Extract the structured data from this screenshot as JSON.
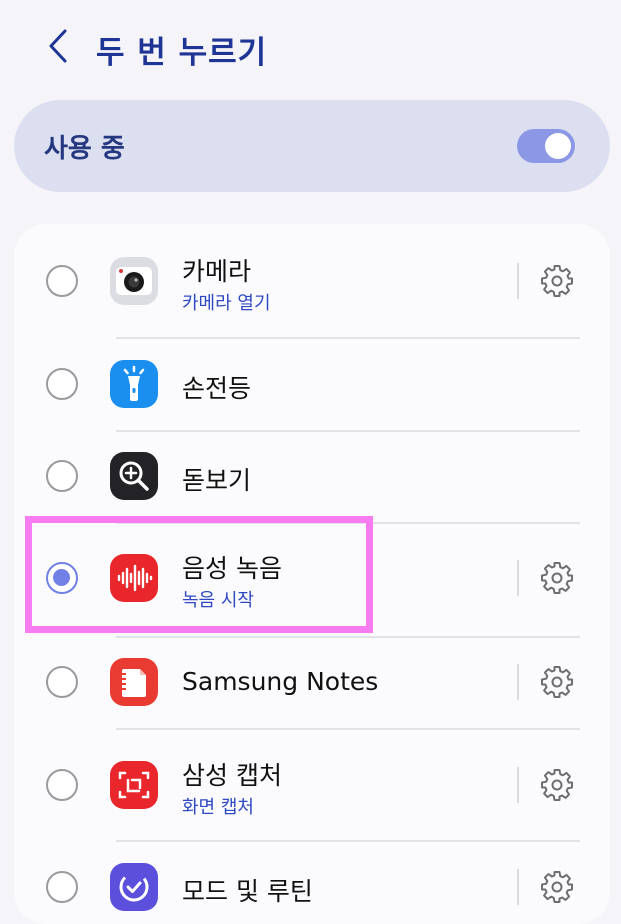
{
  "header": {
    "title": "두 번 누르기"
  },
  "master": {
    "label": "사용 중",
    "enabled": true
  },
  "options": [
    {
      "name": "카메라",
      "subtitle": "카메라 열기",
      "icon": "camera-icon",
      "selected": false,
      "has_settings": true
    },
    {
      "name": "손전등",
      "subtitle": "",
      "icon": "flashlight-icon",
      "selected": false,
      "has_settings": false
    },
    {
      "name": "돋보기",
      "subtitle": "",
      "icon": "magnifier-icon",
      "selected": false,
      "has_settings": false
    },
    {
      "name": "음성 녹음",
      "subtitle": "녹음 시작",
      "icon": "voice-recorder-icon",
      "selected": true,
      "has_settings": true
    },
    {
      "name": "Samsung Notes",
      "subtitle": "",
      "icon": "samsung-notes-icon",
      "selected": false,
      "has_settings": true
    },
    {
      "name": "삼성 캡처",
      "subtitle": "화면 캡처",
      "icon": "samsung-capture-icon",
      "selected": false,
      "has_settings": true
    },
    {
      "name": "모드 및 루틴",
      "subtitle": "",
      "icon": "modes-routines-icon",
      "selected": false,
      "has_settings": true
    }
  ],
  "colors": {
    "accent": "#7180e4",
    "title": "#1f3596",
    "subtitle": "#2f49c2",
    "highlight": "#f77cf1"
  }
}
